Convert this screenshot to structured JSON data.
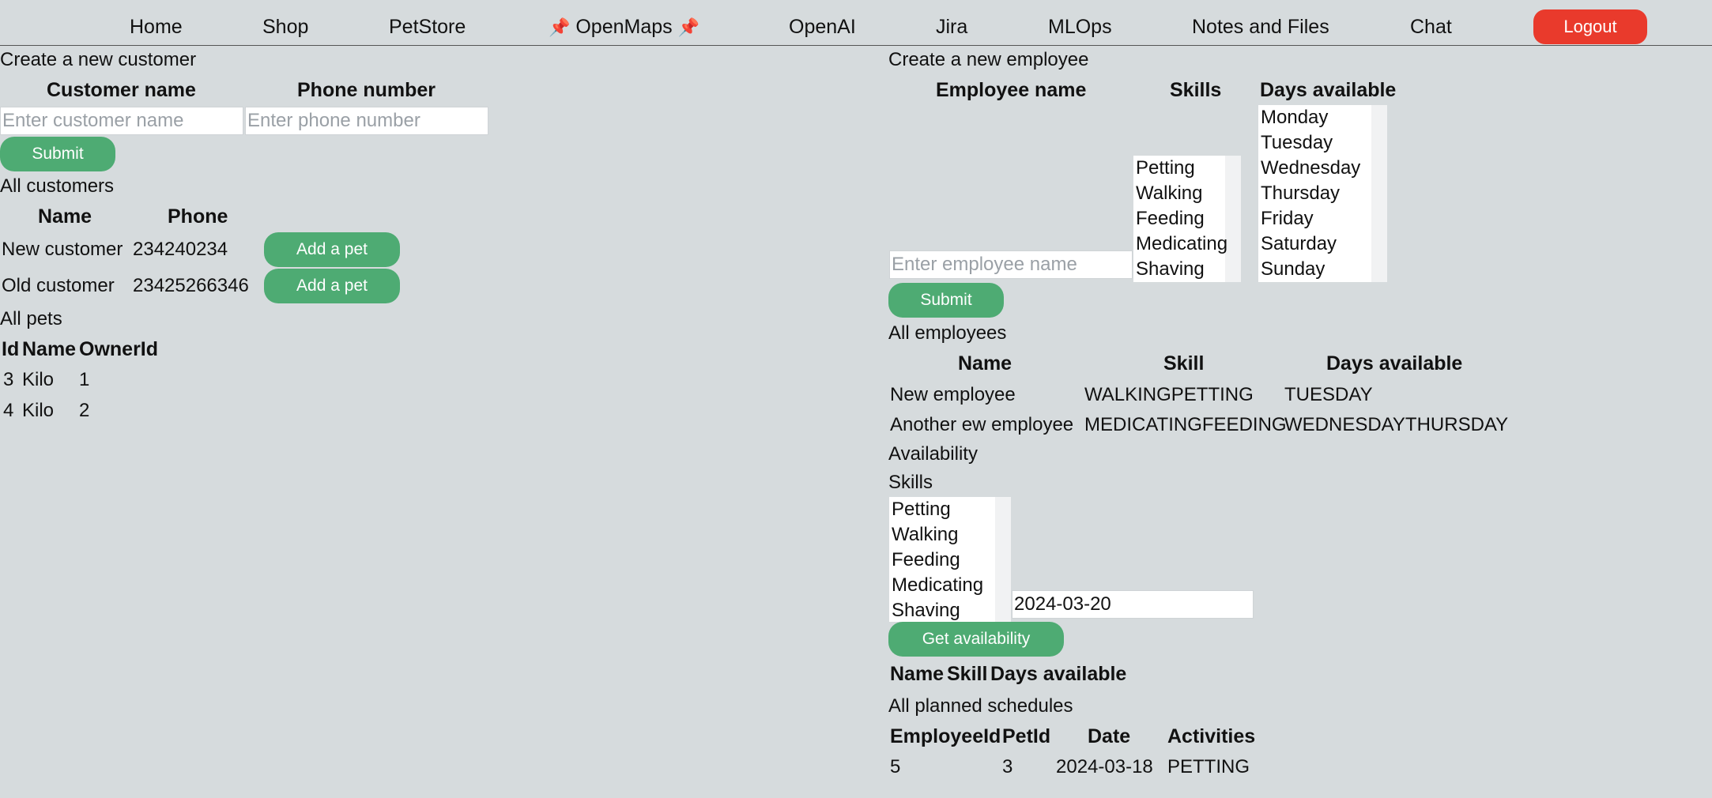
{
  "nav": {
    "items": [
      "Home",
      "Shop",
      "PetStore",
      "OpenMaps",
      "OpenAI",
      "Jira",
      "MLOps",
      "Notes and Files",
      "Chat"
    ],
    "pin_glyph": "📌",
    "logout": "Logout"
  },
  "customer_form": {
    "title": "Create a new customer",
    "name_header": "Customer name",
    "phone_header": "Phone number",
    "name_placeholder": "Enter customer name",
    "phone_placeholder": "Enter phone number",
    "submit": "Submit"
  },
  "customers": {
    "title": "All customers",
    "headers": [
      "Name",
      "Phone"
    ],
    "rows": [
      {
        "name": "New customer",
        "phone": "234240234",
        "action": "Add a pet"
      },
      {
        "name": "Old customer",
        "phone": "23425266346",
        "action": "Add a pet"
      }
    ]
  },
  "pets": {
    "title": "All pets",
    "headers": [
      "Id",
      "Name",
      "OwnerId"
    ],
    "rows": [
      {
        "id": "3",
        "name": "Kilo",
        "owner": "1"
      },
      {
        "id": "4",
        "name": "Kilo",
        "owner": "2"
      }
    ]
  },
  "employee_form": {
    "title": "Create a new employee",
    "name_header": "Employee name",
    "skills_header": "Skills",
    "days_header": "Days available",
    "name_placeholder": "Enter employee name",
    "skills": [
      "Petting",
      "Walking",
      "Feeding",
      "Medicating",
      "Shaving"
    ],
    "days": [
      "Monday",
      "Tuesday",
      "Wednesday",
      "Thursday",
      "Friday",
      "Saturday",
      "Sunday"
    ],
    "submit": "Submit"
  },
  "employees": {
    "title": "All employees",
    "headers": [
      "Name",
      "Skill",
      "Days available"
    ],
    "rows": [
      {
        "name": "New employee",
        "skill": "WALKINGPETTING",
        "days": "TUESDAY"
      },
      {
        "name": "Another ew employee",
        "skill": "MEDICATINGFEEDING",
        "days": "WEDNESDAYTHURSDAY"
      }
    ]
  },
  "availability": {
    "title": "Availability",
    "skills_label": "Skills",
    "skills": [
      "Petting",
      "Walking",
      "Feeding",
      "Medicating",
      "Shaving"
    ],
    "date_value": "2024-03-20",
    "button": "Get availability",
    "headers": [
      "Name",
      "Skill",
      "Days available"
    ]
  },
  "schedules": {
    "title": "All planned schedules",
    "headers": [
      "EmployeeId",
      "PetId",
      "Date",
      "Activities"
    ],
    "rows": [
      {
        "employee": "5",
        "pet": "3",
        "date": "2024-03-18",
        "activities": "PETTING"
      }
    ]
  },
  "colors": {
    "background": "#d6dbdd",
    "accent_green": "#4eab73",
    "logout_red": "#e93a2c"
  }
}
